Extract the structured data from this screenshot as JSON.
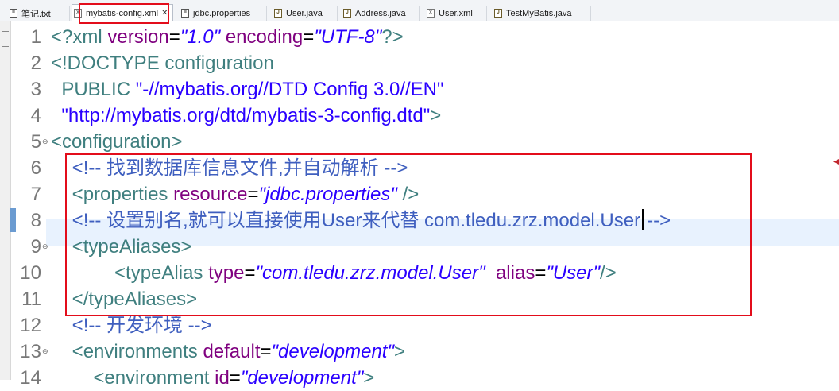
{
  "tabs": [
    {
      "label": "笔记.txt",
      "icon": "text-file-icon",
      "active": false
    },
    {
      "label": "mybatis-config.xml",
      "icon": "xml-file-icon",
      "active": true,
      "close": "✕"
    },
    {
      "label": "jdbc.properties",
      "icon": "properties-file-icon",
      "active": false
    },
    {
      "label": "User.java",
      "icon": "java-file-icon",
      "active": false
    },
    {
      "label": "Address.java",
      "icon": "java-file-icon",
      "active": false
    },
    {
      "label": "User.xml",
      "icon": "xml-file-icon",
      "active": false
    },
    {
      "label": "TestMyBatis.java",
      "icon": "java-file-icon",
      "active": false
    }
  ],
  "editor": {
    "current_line": 8,
    "lines": [
      {
        "num": "1",
        "tokens": [
          [
            "pi",
            "<?xml "
          ],
          [
            "an",
            "version"
          ],
          [
            "tx",
            "="
          ],
          [
            "av",
            "\"1.0\""
          ],
          [
            "tx",
            " "
          ],
          [
            "an",
            "encoding"
          ],
          [
            "tx",
            "="
          ],
          [
            "av",
            "\"UTF-8\""
          ],
          [
            "pi",
            "?>"
          ]
        ]
      },
      {
        "num": "2",
        "tokens": [
          [
            "tg",
            "<!DOCTYPE configuration"
          ]
        ]
      },
      {
        "num": "3",
        "tokens": [
          [
            "tg",
            "  PUBLIC "
          ],
          [
            "st",
            "\"-//mybatis.org//DTD Config 3.0//EN\""
          ]
        ]
      },
      {
        "num": "4",
        "tokens": [
          [
            "st",
            "  \"http://mybatis.org/dtd/mybatis-3-config.dtd\""
          ],
          [
            "tg",
            ">"
          ]
        ]
      },
      {
        "num": "5",
        "fold": true,
        "tokens": [
          [
            "tg",
            "<configuration>"
          ]
        ]
      },
      {
        "num": "6",
        "tokens": [
          [
            "tx",
            "    "
          ],
          [
            "cm",
            "<!-- 找到数据库信息文件,并自动解析 -->"
          ]
        ]
      },
      {
        "num": "7",
        "tokens": [
          [
            "tx",
            "    "
          ],
          [
            "tg",
            "<properties "
          ],
          [
            "an",
            "resource"
          ],
          [
            "tx",
            "="
          ],
          [
            "av",
            "\"jdbc.properties\""
          ],
          [
            "tx",
            " "
          ],
          [
            "tg",
            "/>"
          ]
        ]
      },
      {
        "num": "8",
        "caret": true,
        "tokens": [
          [
            "tx",
            "    "
          ],
          [
            "cm",
            "<!-- 设置别名,就可以直接使用User来代替 com.tledu.zrz.model.User"
          ],
          [
            "caret",
            ""
          ],
          [
            "cm",
            "-->"
          ]
        ]
      },
      {
        "num": "9",
        "fold": true,
        "tokens": [
          [
            "tx",
            "    "
          ],
          [
            "tg",
            "<typeAliases>"
          ]
        ]
      },
      {
        "num": "10",
        "tokens": [
          [
            "tx",
            "            "
          ],
          [
            "tg",
            "<typeAlias "
          ],
          [
            "an",
            "type"
          ],
          [
            "tx",
            "="
          ],
          [
            "av",
            "\"com.tledu.zrz.model.User\""
          ],
          [
            "tx",
            "  "
          ],
          [
            "an",
            "alias"
          ],
          [
            "tx",
            "="
          ],
          [
            "av",
            "\"User\""
          ],
          [
            "tg",
            "/>"
          ]
        ]
      },
      {
        "num": "11",
        "tokens": [
          [
            "tx",
            "    "
          ],
          [
            "tg",
            "</typeAliases>"
          ]
        ]
      },
      {
        "num": "12",
        "tokens": [
          [
            "tx",
            "    "
          ],
          [
            "cm",
            "<!-- 开发环境 -->"
          ]
        ]
      },
      {
        "num": "13",
        "fold": true,
        "tokens": [
          [
            "tx",
            "    "
          ],
          [
            "tg",
            "<environments "
          ],
          [
            "an",
            "default"
          ],
          [
            "tx",
            "="
          ],
          [
            "av",
            "\"development\""
          ],
          [
            "tg",
            ">"
          ]
        ]
      },
      {
        "num": "14",
        "tokens": [
          [
            "tx",
            "        "
          ],
          [
            "tg",
            "<environment "
          ],
          [
            "an",
            "id"
          ],
          [
            "tx",
            "="
          ],
          [
            "av",
            "\"development\""
          ],
          [
            "tg",
            ">"
          ]
        ]
      }
    ]
  },
  "colors": {
    "highlight_box": "#e30d1b",
    "tag": "#3f7f7f",
    "attribute_name": "#7f007f",
    "attribute_value": "#2a00ff",
    "comment": "#3f5fbf",
    "current_line_bg": "#e8f2fe"
  }
}
